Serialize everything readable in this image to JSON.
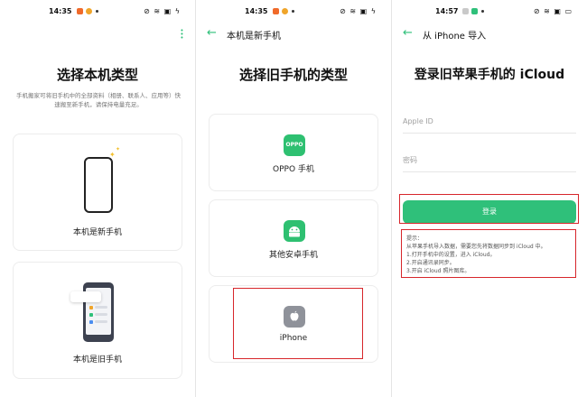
{
  "panel1": {
    "status": {
      "time": "14:35",
      "icons": "⊘ ≋ ▣ ϟ"
    },
    "title": "选择本机类型",
    "description": "手机搬家可将旧手机中的全部资料（相册、联系人、应用等）快速搬至新手机，请保持电量充足。",
    "cards": [
      {
        "label": "本机是新手机"
      },
      {
        "label": "本机是旧手机"
      }
    ]
  },
  "panel2": {
    "status": {
      "time": "14:35",
      "icons": "⊘ ≋ ▣ ϟ"
    },
    "nav_title": "本机是新手机",
    "title": "选择旧手机的类型",
    "cards": [
      {
        "label": "OPPO 手机",
        "icon_text": "OPPO"
      },
      {
        "label": "其他安卓手机"
      },
      {
        "label": "iPhone"
      }
    ]
  },
  "panel3": {
    "status": {
      "time": "14:57",
      "icons": "⊘ ≋ ▣ ▭"
    },
    "nav_title": "从 iPhone 导入",
    "title": "登录旧苹果手机的 iCloud",
    "apple_id_placeholder": "Apple ID",
    "password_placeholder": "密码",
    "login_label": "登录",
    "tips": [
      "提示：",
      "从苹果手机导入数据，需要您先将数据同步到 iCloud 中。",
      "1.打开手机中的设置，进入 iCloud。",
      "2.开启通讯录同步。",
      "3.开启 iCloud 照片图库。"
    ]
  },
  "colors": {
    "accent": "#2fc07a",
    "highlight": "#d7262b",
    "status_icon_orange": "#f06a2a"
  }
}
